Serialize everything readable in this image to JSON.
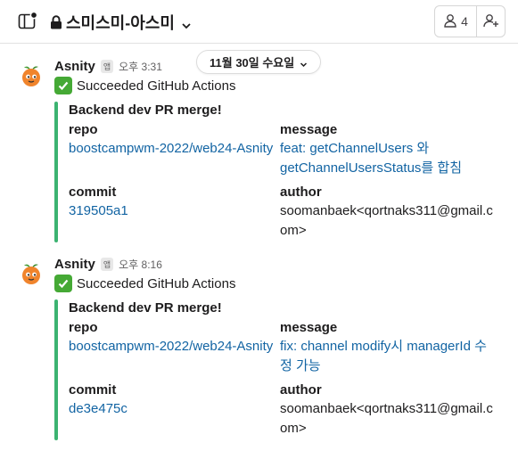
{
  "header": {
    "channel_name": "스미스미-아스미",
    "member_count": "4"
  },
  "date_divider": {
    "label": "11월 30일 수요일"
  },
  "messages": [
    {
      "sender": "Asnity",
      "app_badge": "앱",
      "time": "오후 3:31",
      "text": "Succeeded GitHub Actions",
      "attachment": {
        "title": "Backend dev PR merge!",
        "repo_label": "repo",
        "repo_value": "boostcampwm-2022/web24-Asnity",
        "message_label": "message",
        "message_line1": "feat: getChannelUsers 와",
        "message_line2": "getChannelUsersStatus를 합침",
        "commit_label": "commit",
        "commit_value": "319505a1",
        "author_label": "author",
        "author_line1": "soomanbaek<qortnaks311@gmail.c",
        "author_line2": "om>"
      }
    },
    {
      "sender": "Asnity",
      "app_badge": "앱",
      "time": "오후 8:16",
      "text": "Succeeded GitHub Actions",
      "attachment": {
        "title": "Backend dev PR merge!",
        "repo_label": "repo",
        "repo_value": "boostcampwm-2022/web24-Asnity",
        "message_label": "message",
        "message_line1": "fix: channel modify시 managerId 수",
        "message_line2": "정 가능",
        "commit_label": "commit",
        "commit_value": "de3e475c",
        "author_label": "author",
        "author_line1": "soomanbaek<qortnaks311@gmail.c",
        "author_line2": "om>"
      }
    }
  ],
  "colors": {
    "link": "#1264a3",
    "attachment_bar": "#3cb371",
    "check": "#45a935",
    "avatar": "#f0842c"
  },
  "icons": [
    "sidebar-toggle-icon",
    "lock-icon",
    "chevron-down-icon",
    "person-icon",
    "add-person-icon",
    "check-mark-icon",
    "asnity-avatar-icon"
  ]
}
